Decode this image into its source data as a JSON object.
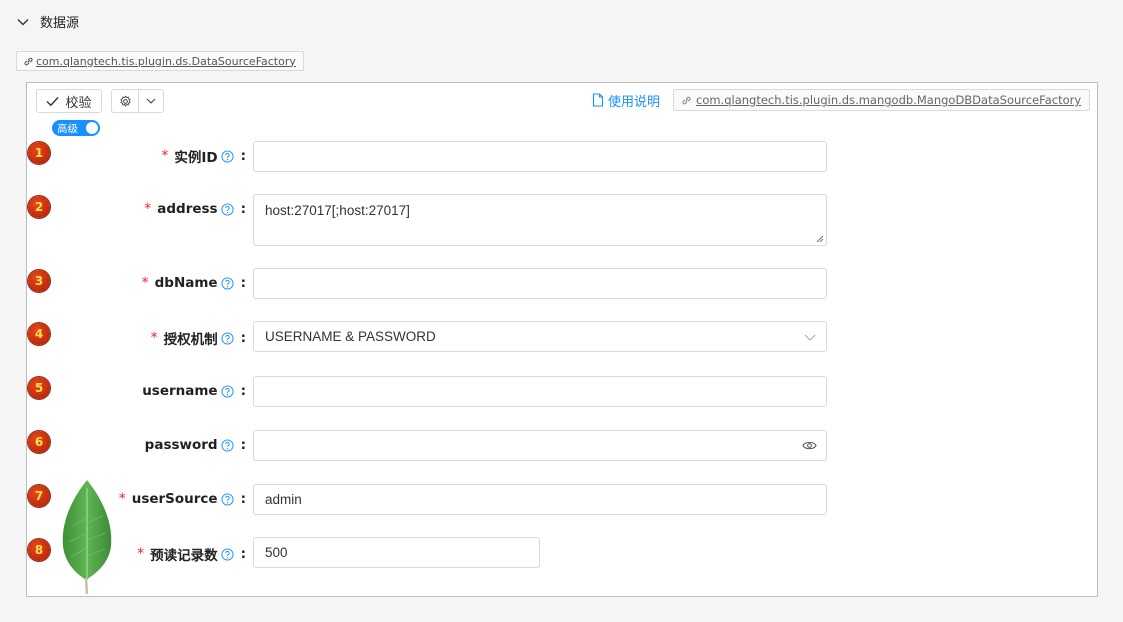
{
  "section": {
    "title": "数据源",
    "icon": "chevron-down-icon"
  },
  "factory_tag": {
    "label": "com.qlangtech.tis.plugin.ds.DataSourceFactory",
    "icon": "link-icon"
  },
  "toolbar": {
    "verify_label": "校验",
    "verify_icon": "check-icon",
    "gear_icon": "gear-icon",
    "caret_icon": "chevron-down-icon",
    "doc_label": "使用说明",
    "doc_icon": "document-icon",
    "impl_label": "com.qlangtech.tis.plugin.ds.mangodb.MangoDBDataSourceFactory",
    "impl_icon": "link-icon"
  },
  "advanced_switch": {
    "label": "高级",
    "on": true
  },
  "fields": [
    {
      "badge": "1",
      "label": "实例ID",
      "required": true,
      "type": "text",
      "value": "",
      "placeholder": ""
    },
    {
      "badge": "2",
      "label": "address",
      "required": true,
      "type": "textarea",
      "value": "",
      "placeholder": "host:27017[;host:27017]"
    },
    {
      "badge": "3",
      "label": "dbName",
      "required": true,
      "type": "text",
      "value": "",
      "placeholder": ""
    },
    {
      "badge": "4",
      "label": "授权机制",
      "required": true,
      "type": "select",
      "value": "USERNAME & PASSWORD"
    },
    {
      "badge": "5",
      "label": "username",
      "required": false,
      "type": "text",
      "value": ""
    },
    {
      "badge": "6",
      "label": "password",
      "required": false,
      "type": "password",
      "value": ""
    },
    {
      "badge": "7",
      "label": "userSource",
      "required": true,
      "type": "text",
      "value": "admin"
    },
    {
      "badge": "8",
      "label": "预读记录数",
      "required": true,
      "type": "number",
      "value": "500"
    }
  ],
  "help_icon": "question-circle-icon",
  "decoration": "mongodb-leaf-logo",
  "colors": {
    "primary": "#1890ff",
    "required": "#f5222d",
    "badge": "#c0290c",
    "leaf": "#4fa446"
  }
}
